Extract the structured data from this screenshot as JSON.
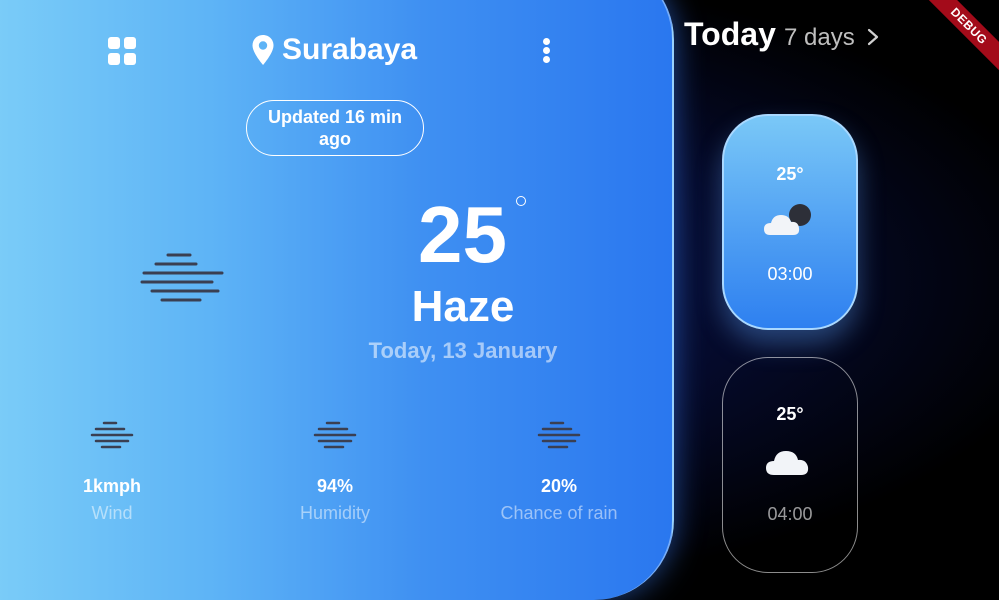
{
  "header": {
    "city": "Surabaya",
    "updated": "Updated 16 min ago"
  },
  "current": {
    "temperature": "25",
    "condition": "Haze",
    "date": "Today, 13 January"
  },
  "stats": [
    {
      "value": "1kmph",
      "label": "Wind",
      "icon": "haze-icon"
    },
    {
      "value": "94%",
      "label": "Humidity",
      "icon": "haze-icon"
    },
    {
      "value": "20%",
      "label": "Chance of rain",
      "icon": "haze-icon"
    }
  ],
  "forecast": {
    "today_label": "Today",
    "days_link": "7 days",
    "cards": [
      {
        "temp": "25°",
        "time": "03:00",
        "icon": "night-cloudy-icon",
        "active": true
      },
      {
        "temp": "25°",
        "time": "04:00",
        "icon": "cloud-icon",
        "active": false
      }
    ]
  },
  "debug_banner": "DEBUG",
  "colors": {
    "panel_start": "#7fd0f8",
    "panel_end": "#2a77ef",
    "background": "#000000",
    "debug": "#a30b1a"
  }
}
